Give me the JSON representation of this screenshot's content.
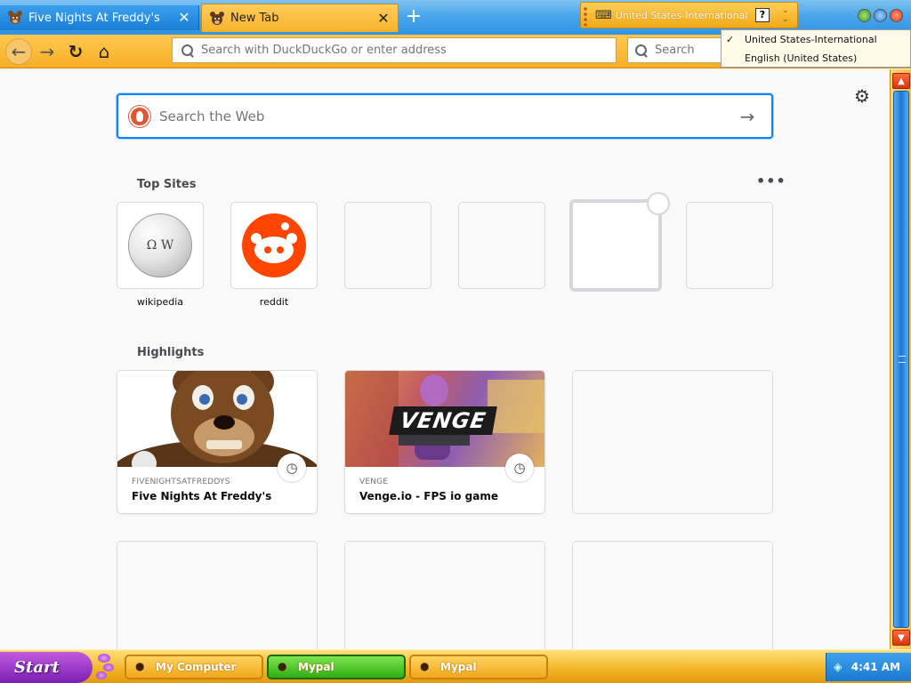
{
  "tabs": [
    {
      "title": "Five Nights At Freddy's",
      "icon": "freddy-favicon",
      "active": false
    },
    {
      "title": "New Tab",
      "icon": "freddy-favicon",
      "active": true
    }
  ],
  "tab_close_glyph": "✕",
  "new_tab_glyph": "+",
  "language_bar": {
    "current": "United States-International",
    "help_glyph": "?",
    "keyboard_icon": "keyboard-icon"
  },
  "language_menu": {
    "options": [
      {
        "label": "United States-International",
        "checked": true
      },
      {
        "label": "English (United States)",
        "checked": false
      }
    ],
    "check_glyph": "✓"
  },
  "navbar": {
    "back_glyph": "←",
    "forward_glyph": "→",
    "reload_glyph": "↻",
    "home_glyph": "⌂",
    "url_placeholder": "Search with DuckDuckGo or enter address",
    "search_placeholder": "Search"
  },
  "newtab": {
    "web_search_placeholder": "Search the Web",
    "go_glyph": "→",
    "gear_glyph": "⚙",
    "top_sites_title": "Top Sites",
    "top_sites_menu": "•••",
    "top_sites": [
      {
        "label": "wikipedia",
        "icon": "wikipedia-globe"
      },
      {
        "label": "reddit",
        "icon": "reddit-logo"
      },
      {
        "label": "",
        "icon": ""
      },
      {
        "label": "",
        "icon": ""
      },
      {
        "label": "",
        "icon": ""
      },
      {
        "label": "",
        "icon": ""
      }
    ],
    "wiki_glyph": "Ω W",
    "highlights_title": "Highlights",
    "highlights": [
      {
        "host": "FIVENIGHTSATFREDDYS",
        "title": "Five Nights At Freddy's",
        "thumb": "freddy-fazbear-image"
      },
      {
        "host": "VENGE",
        "title": "Venge.io - FPS io game",
        "thumb": "venge-game-image",
        "thumb_text": "VENGE"
      }
    ],
    "clock_glyph": "◷"
  },
  "scrollbar": {
    "up_glyph": "▲",
    "down_glyph": "▼"
  },
  "taskbar": {
    "start_label": "Start",
    "tasks": [
      {
        "label": "My Computer",
        "icon": "mickey-icon",
        "style": "yellow"
      },
      {
        "label": "Mypal",
        "icon": "freddy-icon",
        "style": "green"
      },
      {
        "label": "Mypal",
        "icon": "freddy-icon",
        "style": "yellow"
      }
    ],
    "time": "4:41 AM"
  },
  "colors": {
    "tab_strip": "#2f93e3",
    "nav_bar": "#f6ae27",
    "search_focus": "#0a84ff",
    "start_button": "#7b1fb2",
    "reddit": "#ff4500",
    "duckduckgo": "#de5833"
  }
}
